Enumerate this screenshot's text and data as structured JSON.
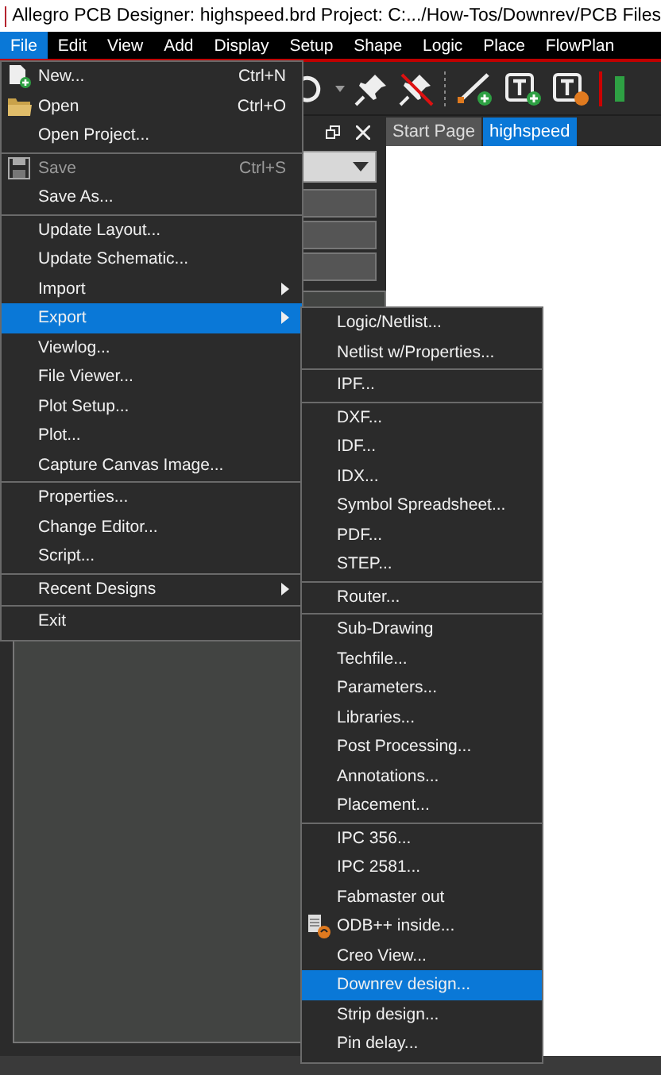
{
  "window": {
    "title": "Allegro PCB Designer: highspeed.brd  Project: C:.../How-Tos/Downrev/PCB Files"
  },
  "menubar": [
    {
      "label": "File",
      "selected": true
    },
    {
      "label": "Edit",
      "selected": false
    },
    {
      "label": "View",
      "selected": false
    },
    {
      "label": "Add",
      "selected": false
    },
    {
      "label": "Display",
      "selected": false
    },
    {
      "label": "Setup",
      "selected": false
    },
    {
      "label": "Shape",
      "selected": false
    },
    {
      "label": "Logic",
      "selected": false
    },
    {
      "label": "Place",
      "selected": false
    },
    {
      "label": "FlowPlan",
      "selected": false
    }
  ],
  "tabs": [
    {
      "label": "Start Page",
      "selected": false
    },
    {
      "label": "highspeed",
      "selected": true
    }
  ],
  "file_menu": [
    {
      "label": "New...",
      "shortcut": "Ctrl+N",
      "kind": "new"
    },
    {
      "label": "Open",
      "shortcut": "Ctrl+O",
      "kind": "open"
    },
    {
      "label": "Open Project..."
    },
    {
      "label": "Save",
      "shortcut": "Ctrl+S",
      "kind": "save",
      "disabled": true,
      "separator_before": true
    },
    {
      "label": "Save As..."
    },
    {
      "label": "Update Layout...",
      "separator_before": true
    },
    {
      "label": "Update Schematic..."
    },
    {
      "label": "Import",
      "submenu": true
    },
    {
      "label": "Export",
      "submenu": true,
      "selected": true
    },
    {
      "label": "Viewlog..."
    },
    {
      "label": "File Viewer..."
    },
    {
      "label": "Plot Setup..."
    },
    {
      "label": "Plot..."
    },
    {
      "label": "Capture Canvas Image..."
    },
    {
      "label": "Properties...",
      "separator_before": true
    },
    {
      "label": "Change Editor..."
    },
    {
      "label": "Script..."
    },
    {
      "label": "Recent Designs",
      "submenu": true,
      "separator_before": true
    },
    {
      "label": "Exit",
      "separator_before": true
    }
  ],
  "export_menu": [
    {
      "label": "Logic/Netlist..."
    },
    {
      "label": "Netlist w/Properties..."
    },
    {
      "label": "IPF...",
      "separator_before": true
    },
    {
      "label": "DXF...",
      "separator_before": true
    },
    {
      "label": "IDF..."
    },
    {
      "label": "IDX..."
    },
    {
      "label": "Symbol Spreadsheet..."
    },
    {
      "label": "PDF..."
    },
    {
      "label": "STEP..."
    },
    {
      "label": "Router...",
      "separator_before": true
    },
    {
      "label": "Sub-Drawing",
      "separator_before": true
    },
    {
      "label": "Techfile..."
    },
    {
      "label": "Parameters..."
    },
    {
      "label": "Libraries..."
    },
    {
      "label": "Post Processing..."
    },
    {
      "label": "Annotations..."
    },
    {
      "label": "Placement..."
    },
    {
      "label": "IPC 356...",
      "separator_before": true
    },
    {
      "label": "IPC 2581..."
    },
    {
      "label": "Fabmaster out"
    },
    {
      "label": "ODB++ inside...",
      "kind": "export"
    },
    {
      "label": "Creo View..."
    },
    {
      "label": "Downrev design...",
      "selected": true
    },
    {
      "label": "Strip design..."
    },
    {
      "label": "Pin delay..."
    }
  ]
}
